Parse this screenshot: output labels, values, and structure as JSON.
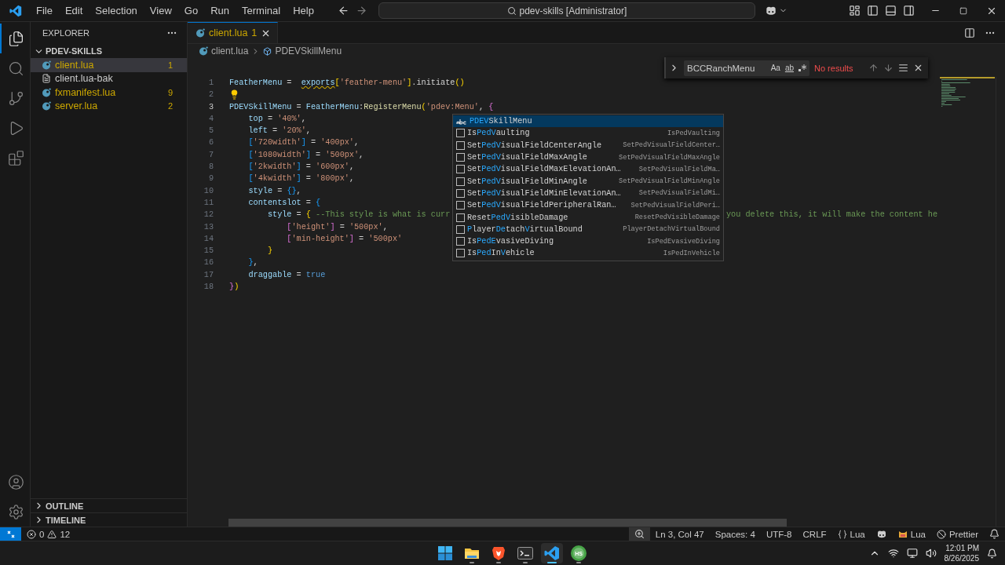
{
  "title_bar": {
    "menu": [
      "File",
      "Edit",
      "Selection",
      "View",
      "Go",
      "Run",
      "Terminal",
      "Help"
    ],
    "command_center": "pdev-skills [Administrator]"
  },
  "activity_bar": [
    {
      "kind": "files",
      "selected": true
    },
    {
      "kind": "search",
      "selected": false
    },
    {
      "kind": "source-control",
      "selected": false
    },
    {
      "kind": "run",
      "selected": false
    },
    {
      "kind": "extensions",
      "selected": false
    },
    {
      "kind": "account",
      "selected": false
    },
    {
      "kind": "settings",
      "selected": false
    }
  ],
  "sidebar": {
    "title": "EXPLORER",
    "folder": "PDEV-SKILLS",
    "files": [
      {
        "name": "client.lua",
        "kind": "lua",
        "badge": "1",
        "selected": true
      },
      {
        "name": "client.lua-bak",
        "kind": "text",
        "selected": false
      },
      {
        "name": "fxmanifest.lua",
        "kind": "lua",
        "badge": "9",
        "selected": false
      },
      {
        "name": "server.lua",
        "kind": "lua",
        "badge": "2",
        "selected": false
      }
    ],
    "sections": [
      {
        "label": "OUTLINE",
        "expanded": false
      },
      {
        "label": "TIMELINE",
        "expanded": false
      }
    ]
  },
  "editor": {
    "tabs": [
      {
        "label": "client.lua",
        "badge": "1",
        "selected": true
      }
    ],
    "breadcrumbs": [
      "client.lua",
      "PDEVSkillMenu"
    ],
    "lines": [
      {
        "number": "1",
        "current": false,
        "lightbulb": false,
        "tokens": [
          {
            "t": "FeatherMenu",
            "kind": "var"
          },
          {
            "t": " =  ",
            "kind": "plain"
          },
          {
            "t": "exports",
            "kind": "warn"
          },
          {
            "t": "[",
            "kind": "b1"
          },
          {
            "t": "'feather-menu'",
            "kind": "str"
          },
          {
            "t": "]",
            "kind": "b1"
          },
          {
            "t": ".initiate",
            "kind": "plain"
          },
          {
            "t": "()",
            "kind": "b1"
          }
        ]
      },
      {
        "number": "2",
        "current": false,
        "lightbulb": true
      },
      {
        "number": "3",
        "current": true,
        "lightbulb": false,
        "tokens": [
          {
            "t": "PDEVSkillMenu",
            "kind": "var"
          },
          {
            "t": " = ",
            "kind": "plain"
          },
          {
            "t": "FeatherMenu",
            "kind": "var"
          },
          {
            "t": ":",
            "kind": "plain"
          },
          {
            "t": "RegisterMenu",
            "kind": "fn"
          },
          {
            "t": "(",
            "kind": "b1"
          },
          {
            "t": "'pdev:Menu'",
            "kind": "str"
          },
          {
            "t": ", ",
            "kind": "plain"
          },
          {
            "t": "{",
            "kind": "b2"
          }
        ]
      },
      {
        "number": "4",
        "current": false,
        "lightbulb": false,
        "tokens": [
          {
            "t": "    top",
            "kind": "var"
          },
          {
            "t": " = ",
            "kind": "plain"
          },
          {
            "t": "'40%'",
            "kind": "str"
          },
          {
            "t": ",",
            "kind": "plain"
          }
        ]
      },
      {
        "number": "5",
        "current": false,
        "lightbulb": false,
        "tokens": [
          {
            "t": "    left",
            "kind": "var"
          },
          {
            "t": " = ",
            "kind": "plain"
          },
          {
            "t": "'20%'",
            "kind": "str"
          },
          {
            "t": ",",
            "kind": "plain"
          }
        ]
      },
      {
        "number": "6",
        "current": false,
        "lightbulb": false,
        "tokens": [
          {
            "t": "    [",
            "kind": "b3"
          },
          {
            "t": "'720width'",
            "kind": "str"
          },
          {
            "t": "]",
            "kind": "b3"
          },
          {
            "t": " = ",
            "kind": "plain"
          },
          {
            "t": "'400px'",
            "kind": "str"
          },
          {
            "t": ",",
            "kind": "plain"
          }
        ]
      },
      {
        "number": "7",
        "current": false,
        "lightbulb": false,
        "tokens": [
          {
            "t": "    [",
            "kind": "b3"
          },
          {
            "t": "'1080width'",
            "kind": "str"
          },
          {
            "t": "]",
            "kind": "b3"
          },
          {
            "t": " = ",
            "kind": "plain"
          },
          {
            "t": "'500px'",
            "kind": "str"
          },
          {
            "t": ",",
            "kind": "plain"
          }
        ]
      },
      {
        "number": "8",
        "current": false,
        "lightbulb": false,
        "tokens": [
          {
            "t": "    [",
            "kind": "b3"
          },
          {
            "t": "'2kwidth'",
            "kind": "str"
          },
          {
            "t": "]",
            "kind": "b3"
          },
          {
            "t": " = ",
            "kind": "plain"
          },
          {
            "t": "'600px'",
            "kind": "str"
          },
          {
            "t": ",",
            "kind": "plain"
          }
        ]
      },
      {
        "number": "9",
        "current": false,
        "lightbulb": false,
        "tokens": [
          {
            "t": "    [",
            "kind": "b3"
          },
          {
            "t": "'4kwidth'",
            "kind": "str"
          },
          {
            "t": "]",
            "kind": "b3"
          },
          {
            "t": " = ",
            "kind": "plain"
          },
          {
            "t": "'800px'",
            "kind": "str"
          },
          {
            "t": ",",
            "kind": "plain"
          }
        ]
      },
      {
        "number": "10",
        "current": false,
        "lightbulb": false,
        "tokens": [
          {
            "t": "    style",
            "kind": "var"
          },
          {
            "t": " = ",
            "kind": "plain"
          },
          {
            "t": "{}",
            "kind": "b3"
          },
          {
            "t": ",",
            "kind": "plain"
          }
        ]
      },
      {
        "number": "11",
        "current": false,
        "lightbulb": false,
        "tokens": [
          {
            "t": "    contentslot",
            "kind": "var"
          },
          {
            "t": " = ",
            "kind": "plain"
          },
          {
            "t": "{",
            "kind": "b3"
          }
        ]
      },
      {
        "number": "12",
        "current": false,
        "lightbulb": false,
        "tokens": [
          {
            "t": "        style",
            "kind": "var"
          },
          {
            "t": " = ",
            "kind": "plain"
          },
          {
            "t": "{",
            "kind": "b1"
          },
          {
            "t": " --This style is what is curr",
            "kind": "comment"
          }
        ],
        "tail": "you delete this, it will make the content he"
      },
      {
        "number": "13",
        "current": false,
        "lightbulb": false,
        "tokens": [
          {
            "t": "            [",
            "kind": "b2"
          },
          {
            "t": "'height'",
            "kind": "str"
          },
          {
            "t": "]",
            "kind": "b2"
          },
          {
            "t": " = ",
            "kind": "plain"
          },
          {
            "t": "'500px'",
            "kind": "str"
          },
          {
            "t": ",",
            "kind": "plain"
          }
        ]
      },
      {
        "number": "14",
        "current": false,
        "lightbulb": false,
        "tokens": [
          {
            "t": "            [",
            "kind": "b2"
          },
          {
            "t": "'min-height'",
            "kind": "str"
          },
          {
            "t": "]",
            "kind": "b2"
          },
          {
            "t": " = ",
            "kind": "plain"
          },
          {
            "t": "'500px'",
            "kind": "str"
          }
        ]
      },
      {
        "number": "15",
        "current": false,
        "lightbulb": false,
        "tokens": [
          {
            "t": "        }",
            "kind": "b1"
          }
        ]
      },
      {
        "number": "16",
        "current": false,
        "lightbulb": false,
        "tokens": [
          {
            "t": "    }",
            "kind": "b3"
          },
          {
            "t": ",",
            "kind": "plain"
          }
        ]
      },
      {
        "number": "17",
        "current": false,
        "lightbulb": false,
        "tokens": [
          {
            "t": "    draggable",
            "kind": "var"
          },
          {
            "t": " = ",
            "kind": "plain"
          },
          {
            "t": "true",
            "kind": "bool"
          }
        ]
      },
      {
        "number": "18",
        "current": false,
        "lightbulb": false,
        "tokens": [
          {
            "t": "}",
            "kind": "b2"
          },
          {
            "t": ")",
            "kind": "b1"
          }
        ]
      }
    ],
    "suggestions": [
      {
        "kind": "word",
        "selected": true,
        "parts": [
          {
            "text": "PDEV",
            "match": true
          },
          {
            "text": "SkillMenu",
            "match": false
          }
        ]
      },
      {
        "kind": "function",
        "selected": false,
        "parts": [
          {
            "text": "Is",
            "match": false
          },
          {
            "text": "PedV",
            "match": true
          },
          {
            "text": "aulting",
            "match": false
          }
        ],
        "detail": "IsPedVaulting"
      },
      {
        "kind": "function",
        "selected": false,
        "parts": [
          {
            "text": "Set",
            "match": false
          },
          {
            "text": "PedV",
            "match": true
          },
          {
            "text": "isualFieldCenterAngle",
            "match": false
          }
        ],
        "detail": "SetPedVisualFieldCenter…"
      },
      {
        "kind": "function",
        "selected": false,
        "parts": [
          {
            "text": "Set",
            "match": false
          },
          {
            "text": "PedV",
            "match": true
          },
          {
            "text": "isualFieldMaxAngle",
            "match": false
          }
        ],
        "detail": "SetPedVisualFieldMaxAngle"
      },
      {
        "kind": "function",
        "selected": false,
        "parts": [
          {
            "text": "Set",
            "match": false
          },
          {
            "text": "PedV",
            "match": true
          },
          {
            "text": "isualFieldMaxElevationAn…",
            "match": false
          }
        ],
        "detail": "SetPedVisualFieldMa…"
      },
      {
        "kind": "function",
        "selected": false,
        "parts": [
          {
            "text": "Set",
            "match": false
          },
          {
            "text": "PedV",
            "match": true
          },
          {
            "text": "isualFieldMinAngle",
            "match": false
          }
        ],
        "detail": "SetPedVisualFieldMinAngle"
      },
      {
        "kind": "function",
        "selected": false,
        "parts": [
          {
            "text": "Set",
            "match": false
          },
          {
            "text": "PedV",
            "match": true
          },
          {
            "text": "isualFieldMinElevationAn…",
            "match": false
          }
        ],
        "detail": "SetPedVisualFieldMi…"
      },
      {
        "kind": "function",
        "selected": false,
        "parts": [
          {
            "text": "Set",
            "match": false
          },
          {
            "text": "PedV",
            "match": true
          },
          {
            "text": "isualFieldPeripheralRan…",
            "match": false
          }
        ],
        "detail": "SetPedVisualFieldPeri…"
      },
      {
        "kind": "function",
        "selected": false,
        "parts": [
          {
            "text": "Reset",
            "match": false
          },
          {
            "text": "PedV",
            "match": true
          },
          {
            "text": "isibleDamage",
            "match": false
          }
        ],
        "detail": "ResetPedVisibleDamage"
      },
      {
        "kind": "function",
        "selected": false,
        "parts": [
          {
            "text": "P",
            "match": true
          },
          {
            "text": "layer",
            "match": false
          },
          {
            "text": "De",
            "match": true
          },
          {
            "text": "tach",
            "match": false
          },
          {
            "text": "V",
            "match": true
          },
          {
            "text": "irtualBound",
            "match": false
          }
        ],
        "detail": "PlayerDetachVirtualBound"
      },
      {
        "kind": "function",
        "selected": false,
        "parts": [
          {
            "text": "Is",
            "match": false
          },
          {
            "text": "PedE",
            "match": true
          },
          {
            "text": "vasiveDiving",
            "match": false
          }
        ],
        "detail": "IsPedEvasiveDiving"
      },
      {
        "kind": "function",
        "selected": false,
        "parts": [
          {
            "text": "Is",
            "match": false
          },
          {
            "text": "Ped",
            "match": true
          },
          {
            "text": "In",
            "match": false
          },
          {
            "text": "V",
            "match": true
          },
          {
            "text": "ehicle",
            "match": false
          }
        ],
        "detail": "IsPedInVehicle"
      }
    ],
    "find": {
      "value": "BCCRanchMenu",
      "options": [
        "Aa",
        "ab"
      ],
      "result": "No results"
    }
  },
  "status_bar": {
    "errors": "0",
    "warnings": "12",
    "items": [
      {
        "kind": "zoom"
      },
      {
        "kind": "text",
        "text": "Ln 3, Col 47"
      },
      {
        "kind": "text",
        "text": "Spaces: 4"
      },
      {
        "kind": "text",
        "text": "UTF-8"
      },
      {
        "kind": "text",
        "text": "CRLF"
      },
      {
        "kind": "braces",
        "text": "Lua"
      },
      {
        "kind": "copilot"
      },
      {
        "kind": "cat",
        "text": "Lua"
      },
      {
        "kind": "blocked",
        "text": "Prettier"
      },
      {
        "kind": "bell"
      }
    ]
  },
  "taskbar": {
    "apps": [
      {
        "kind": "start",
        "selected": false
      },
      {
        "kind": "folder",
        "selected": false
      },
      {
        "kind": "browser",
        "selected": false
      },
      {
        "kind": "terminal",
        "selected": false
      },
      {
        "kind": "vscode",
        "selected": true
      },
      {
        "kind": "hs",
        "selected": false,
        "text": "HS"
      }
    ],
    "time": "12:01 PM",
    "date": "8/26/2025"
  }
}
